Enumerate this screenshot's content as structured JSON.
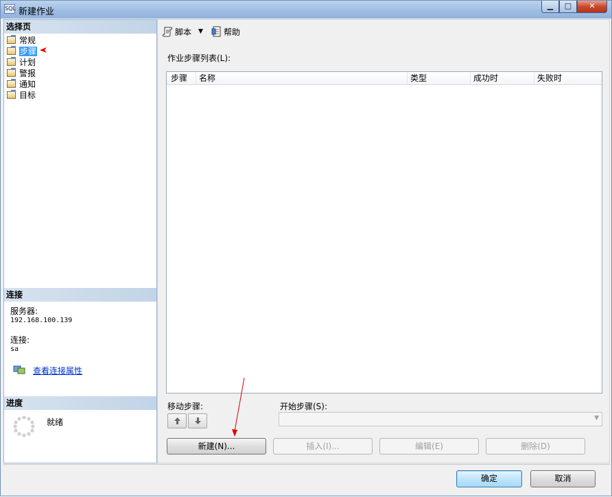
{
  "window": {
    "title": "新建作业",
    "min_glyph": "▁",
    "max_glyph": "□",
    "close_glyph": "✕"
  },
  "left": {
    "select_page_header": "选择页",
    "pages": [
      {
        "label": "常规",
        "icon": "page-icon"
      },
      {
        "label": "步骤",
        "icon": "page-icon",
        "selected": true
      },
      {
        "label": "计划",
        "icon": "page-icon"
      },
      {
        "label": "警报",
        "icon": "page-icon"
      },
      {
        "label": "通知",
        "icon": "page-icon"
      },
      {
        "label": "目标",
        "icon": "page-icon"
      }
    ],
    "connection_header": "连接",
    "server_label": "服务器:",
    "server_value": "192.168.100.139",
    "connection_label": "连接:",
    "connection_value": "sa",
    "view_connection_link": "查看连接属性",
    "progress_header": "进度",
    "progress_status": "就绪"
  },
  "toolbar": {
    "script_label": "脚本",
    "help_label": "帮助"
  },
  "steps": {
    "list_label": "作业步骤列表(L):",
    "columns": [
      "步骤",
      "名称",
      "类型",
      "成功时",
      "失败时"
    ],
    "rows": []
  },
  "move_step_label": "移动步骤:",
  "start_step_label": "开始步骤(S):",
  "start_step_value": "",
  "buttons": {
    "new": "新建(N)...",
    "insert": "插入(I)...",
    "edit": "编辑(E)",
    "delete": "删除(D)"
  },
  "footer": {
    "ok": "确定",
    "cancel": "取消"
  },
  "colors": {
    "selection": "#3399ff",
    "link": "#0033cc",
    "annotation_arrow": "#e00000"
  }
}
